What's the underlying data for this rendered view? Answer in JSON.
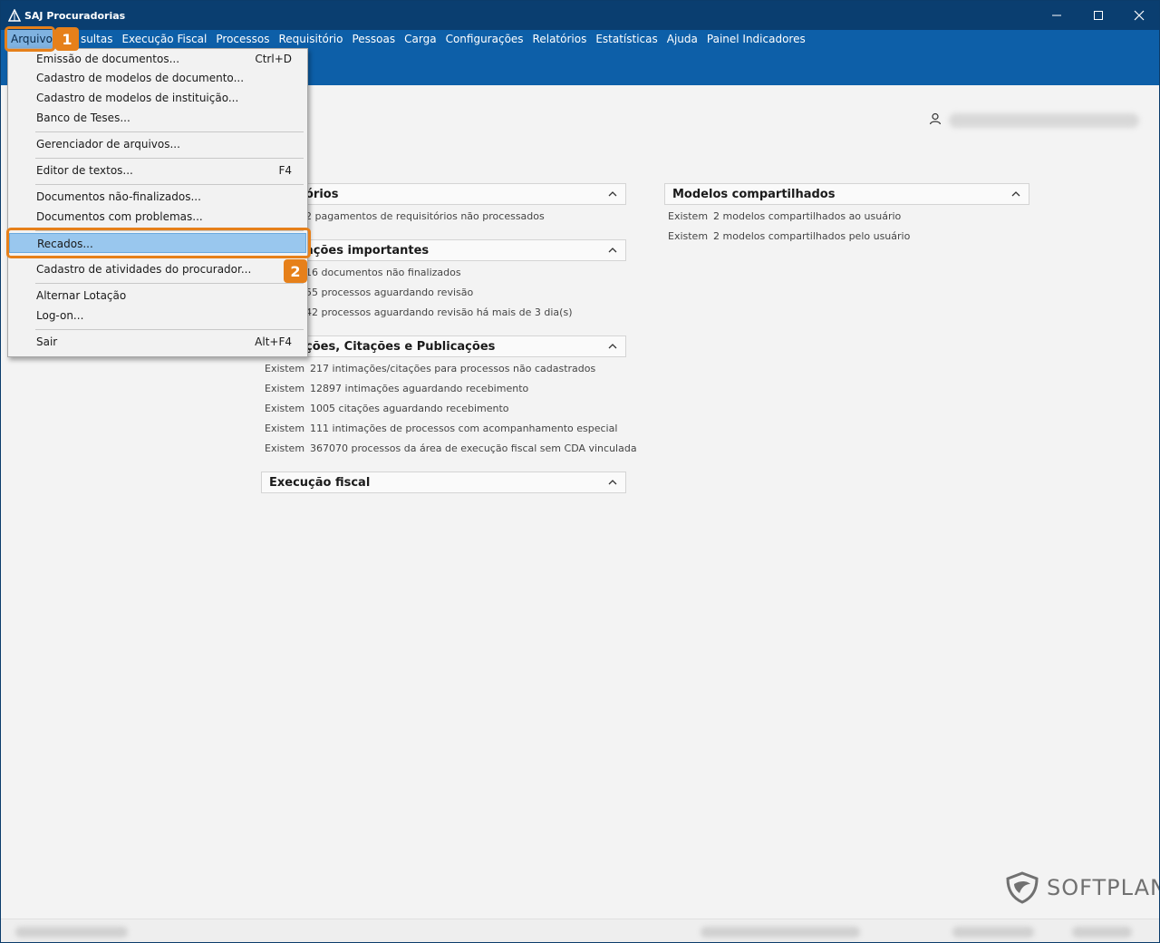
{
  "window": {
    "title": "SAJ Procuradorias"
  },
  "menubar": {
    "items": [
      "Arquivo",
      "Consultas",
      "Execução Fiscal",
      "Processos",
      "Requisitório",
      "Pessoas",
      "Carga",
      "Configurações",
      "Relatórios",
      "Estatísticas",
      "Ajuda",
      "Painel Indicadores"
    ],
    "visible_second": "sultas"
  },
  "menu": {
    "items": [
      {
        "label": "Emissão de documentos...",
        "shortcut": "Ctrl+D"
      },
      {
        "label": "Cadastro de modelos de documento...",
        "shortcut": ""
      },
      {
        "label": "Cadastro de modelos de instituição...",
        "shortcut": ""
      },
      {
        "label": "Banco de Teses...",
        "shortcut": ""
      },
      {
        "label": "Gerenciador de arquivos...",
        "shortcut": ""
      },
      {
        "label": "Editor de textos...",
        "shortcut": "F4"
      },
      {
        "label": "Documentos não-finalizados...",
        "shortcut": ""
      },
      {
        "label": "Documentos com problemas...",
        "shortcut": ""
      },
      {
        "label": "Recados...",
        "shortcut": ""
      },
      {
        "label": "Cadastro de atividades do procurador...",
        "shortcut": ""
      },
      {
        "label": "Alternar Lotação",
        "shortcut": ""
      },
      {
        "label": "Log-on...",
        "shortcut": ""
      },
      {
        "label": "Sair",
        "shortcut": "Alt+F4"
      }
    ]
  },
  "callouts": {
    "step1": "1",
    "step2": "2"
  },
  "panels": {
    "requisitorios": {
      "title": "órios",
      "rows": [
        {
          "ex": "",
          "text": "2 pagamentos de requisitórios não processados"
        }
      ]
    },
    "informacoes": {
      "title": "ações importantes",
      "rows": [
        {
          "ex": "",
          "text": "16 documentos não finalizados"
        },
        {
          "ex": "",
          "text": "55 processos aguardando revisão"
        },
        {
          "ex": "",
          "text": "42 processos aguardando revisão há mais de 3 dia(s)"
        }
      ]
    },
    "intimacoes": {
      "title": "ções, Citações e Publicações",
      "rows": [
        {
          "ex": "Existem",
          "text": "217 intimações/citações para processos não cadastrados"
        },
        {
          "ex": "Existem",
          "text": "12897 intimações aguardando recebimento"
        },
        {
          "ex": "Existem",
          "text": "1005 citações aguardando recebimento"
        },
        {
          "ex": "Existem",
          "text": "111 intimações de processos com acompanhamento especial"
        },
        {
          "ex": "Existem",
          "text": "367070 processos da área de execução fiscal sem CDA vinculada"
        }
      ]
    },
    "execucao": {
      "title": "Execução fiscal",
      "rows": []
    },
    "modelos": {
      "title": "Modelos compartilhados",
      "rows": [
        {
          "ex": "Existem",
          "text": "2 modelos compartilhados ao usuário"
        },
        {
          "ex": "Existem",
          "text": "2 modelos compartilhados pelo usuário"
        }
      ]
    }
  },
  "logo": {
    "text": "SOFTPLAN"
  }
}
